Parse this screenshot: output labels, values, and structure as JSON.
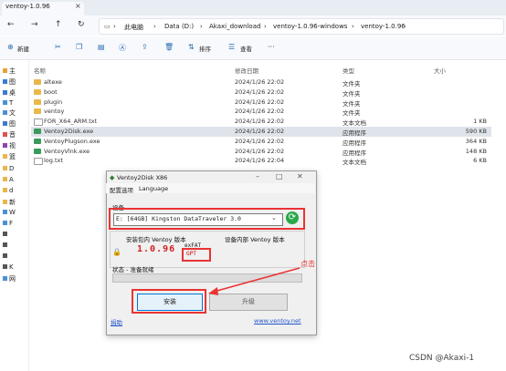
{
  "tab": {
    "title": "ventoy-1.0.96"
  },
  "address": {
    "crumbs": [
      "此电脑",
      "Data (D:)",
      "Akaxi_download",
      "ventoy-1.0.96-windows",
      "ventoy-1.0.96"
    ]
  },
  "toolbar": {
    "new_label": "新建",
    "sort_label": "排序",
    "view_label": "查看"
  },
  "sidebar": {
    "items": [
      "主",
      "图",
      "桌",
      "T",
      "文",
      "图",
      "音",
      "视",
      "篮",
      "D",
      "A",
      "d",
      "新",
      "W",
      "F",
      "",
      "",
      "",
      "K",
      "网"
    ]
  },
  "columns": {
    "name": "名称",
    "date": "修改日期",
    "type": "类型",
    "size": "大小"
  },
  "files": [
    {
      "name": "altexe",
      "date": "2024/1/26 22:02",
      "type": "文件夹",
      "size": "",
      "kind": "folder"
    },
    {
      "name": "boot",
      "date": "2024/1/26 22:02",
      "type": "文件夹",
      "size": "",
      "kind": "folder"
    },
    {
      "name": "plugin",
      "date": "2024/1/26 22:02",
      "type": "文件夹",
      "size": "",
      "kind": "folder"
    },
    {
      "name": "ventoy",
      "date": "2024/1/26 22:02",
      "type": "文件夹",
      "size": "",
      "kind": "folder"
    },
    {
      "name": "FOR_X64_ARM.txt",
      "date": "2024/1/26 22:02",
      "type": "文本文档",
      "size": "1 KB",
      "kind": "txt"
    },
    {
      "name": "Ventoy2Disk.exe",
      "date": "2024/1/26 22:02",
      "type": "应用程序",
      "size": "590 KB",
      "kind": "exe"
    },
    {
      "name": "VentoyPlugson.exe",
      "date": "2024/1/26 22:02",
      "type": "应用程序",
      "size": "364 KB",
      "kind": "exe"
    },
    {
      "name": "VentoyVlnk.exe",
      "date": "2024/1/26 22:02",
      "type": "应用程序",
      "size": "148 KB",
      "kind": "exe"
    },
    {
      "name": "log.txt",
      "date": "2024/1/26 22:04",
      "type": "文本文档",
      "size": "6 KB",
      "kind": "txt"
    }
  ],
  "dialog": {
    "title": "Ventoy2Disk  X86",
    "menu": [
      "配置选项",
      "Language"
    ],
    "device_label": "设备",
    "device_value": "E: [64GB] Kingston DataTraveler 3.0",
    "pkg_version_label": "安装包内 Ventoy 版本",
    "device_version_label": "设备内部 Ventoy 版本",
    "pkg_version": "1.0.96",
    "fs": "exFAT",
    "partition_style": "GPT",
    "status": "状态 - 准备就绪",
    "progress": 0,
    "install_label": "安装",
    "upgrade_label": "升级",
    "donate_label": "捐助",
    "website": "www.ventoy.net"
  },
  "annotation": {
    "text": "点击"
  },
  "watermark": "CSDN @Akaxi-1",
  "colors": {
    "accent": "#0078d7",
    "highlight": "#ea3333",
    "folder": "#e8b84a"
  }
}
